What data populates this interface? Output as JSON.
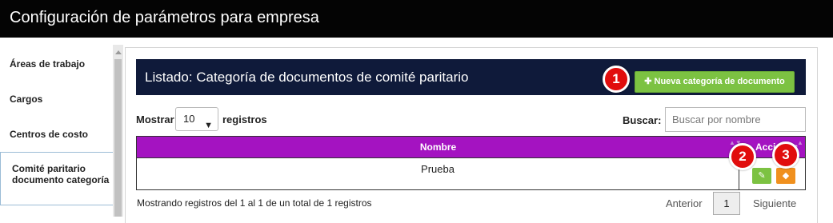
{
  "window": {
    "title": "Configuración de parámetros para empresa"
  },
  "sidebar": {
    "items": [
      {
        "label": "Áreas de trabajo"
      },
      {
        "label": "Cargos"
      },
      {
        "label": "Centros de costo"
      },
      {
        "label": "Comité paritario documento categoría",
        "active": true
      }
    ]
  },
  "listing": {
    "title": "Listado: Categoría de documentos de comité paritario",
    "new_button": "✚ Nueva categoría de documento"
  },
  "controls": {
    "show_label": "Mostrar",
    "show_value": "10",
    "records_label": "registros",
    "search_label": "Buscar:",
    "search_placeholder": "Buscar por nombre"
  },
  "table": {
    "headers": [
      "Nombre",
      "Acciones"
    ],
    "rows": [
      {
        "name": "Prueba"
      }
    ]
  },
  "footer": {
    "info": "Mostrando registros del 1 al 1 de un total de 1 registros",
    "prev": "Anterior",
    "page": "1",
    "next": "Siguiente"
  },
  "badges": [
    "1",
    "2",
    "3"
  ],
  "colors": {
    "titlebar": "#040404",
    "header_bg": "#0f1a3a",
    "add_button": "#7cc242",
    "table_header": "#a413c1",
    "edit_button": "#7cc242",
    "tag_button": "#f0901e",
    "badge": "#e10d0d"
  }
}
